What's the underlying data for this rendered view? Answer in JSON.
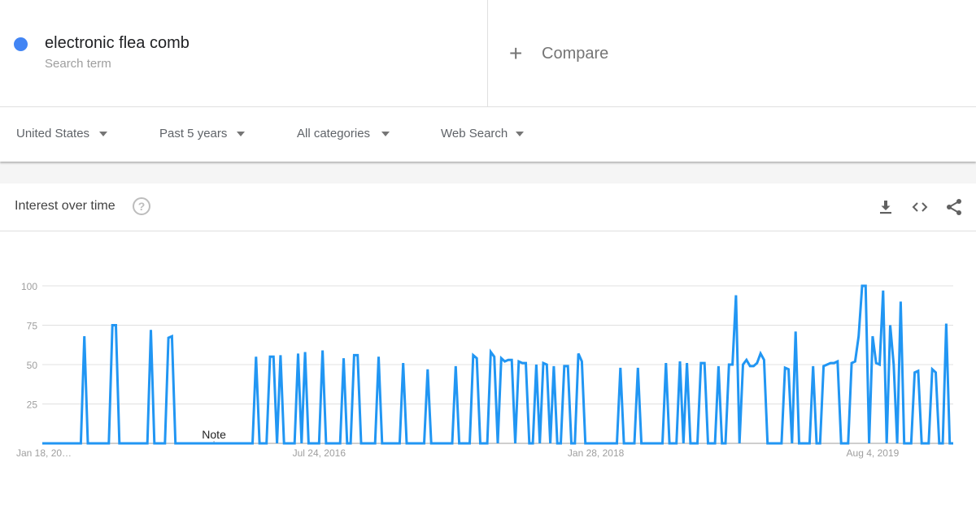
{
  "search_term": {
    "name": "electronic flea comb",
    "type": "Search term",
    "color": "#4285f4"
  },
  "compare": {
    "icon": "plus-icon",
    "label": "Compare"
  },
  "filters": [
    {
      "label": "United States"
    },
    {
      "label": "Past 5 years"
    },
    {
      "label": "All categories"
    },
    {
      "label": "Web Search"
    }
  ],
  "card": {
    "title": "Interest over time",
    "help_icon": "help-icon",
    "actions": [
      "download-icon",
      "embed-icon",
      "share-icon"
    ]
  },
  "chart_data": {
    "type": "line",
    "title": "Interest over time",
    "xlabel": "",
    "ylabel": "",
    "ylim": [
      0,
      100
    ],
    "yticks": [
      25,
      50,
      75,
      100
    ],
    "xtick_labels": [
      {
        "index": 0,
        "label": "Jan 18, 20…"
      },
      {
        "index": 79,
        "label": "Jul 24, 2016"
      },
      {
        "index": 158,
        "label": "Jan 28, 2018"
      },
      {
        "index": 237,
        "label": "Aug 4, 2019"
      }
    ],
    "annotation": {
      "index": 49,
      "label": "Note"
    },
    "grid": true,
    "legend": "none",
    "n_points": 261,
    "frequency": "weekly",
    "series": [
      {
        "name": "electronic flea comb",
        "color": "#2196f3",
        "nonzero_points": [
          [
            12,
            68
          ],
          [
            20,
            75
          ],
          [
            21,
            75
          ],
          [
            31,
            72
          ],
          [
            36,
            67
          ],
          [
            37,
            68
          ],
          [
            61,
            55
          ],
          [
            65,
            55
          ],
          [
            66,
            55
          ],
          [
            68,
            56
          ],
          [
            73,
            57
          ],
          [
            75,
            58
          ],
          [
            80,
            59
          ],
          [
            86,
            54
          ],
          [
            89,
            56
          ],
          [
            90,
            56
          ],
          [
            96,
            55
          ],
          [
            103,
            51
          ],
          [
            110,
            47
          ],
          [
            118,
            49
          ],
          [
            123,
            56
          ],
          [
            124,
            54
          ],
          [
            128,
            58
          ],
          [
            129,
            55
          ],
          [
            131,
            54
          ],
          [
            132,
            52
          ],
          [
            133,
            53
          ],
          [
            134,
            53
          ],
          [
            136,
            52
          ],
          [
            137,
            51
          ],
          [
            138,
            51
          ],
          [
            141,
            50
          ],
          [
            143,
            51
          ],
          [
            144,
            50
          ],
          [
            146,
            49
          ],
          [
            149,
            49
          ],
          [
            150,
            49
          ],
          [
            153,
            57
          ],
          [
            154,
            52
          ],
          [
            165,
            48
          ],
          [
            170,
            48
          ],
          [
            178,
            51
          ],
          [
            182,
            52
          ],
          [
            184,
            51
          ],
          [
            188,
            51
          ],
          [
            189,
            51
          ],
          [
            193,
            49
          ],
          [
            196,
            50
          ],
          [
            197,
            50
          ],
          [
            198,
            94
          ],
          [
            200,
            50
          ],
          [
            201,
            53
          ],
          [
            202,
            49
          ],
          [
            203,
            49
          ],
          [
            204,
            51
          ],
          [
            205,
            57
          ],
          [
            206,
            53
          ],
          [
            212,
            48
          ],
          [
            213,
            47
          ],
          [
            215,
            71
          ],
          [
            220,
            49
          ],
          [
            223,
            49
          ],
          [
            224,
            50
          ],
          [
            225,
            51
          ],
          [
            226,
            51
          ],
          [
            227,
            52
          ],
          [
            231,
            51
          ],
          [
            232,
            52
          ],
          [
            233,
            68
          ],
          [
            234,
            100
          ],
          [
            235,
            100
          ],
          [
            237,
            68
          ],
          [
            238,
            51
          ],
          [
            239,
            50
          ],
          [
            240,
            97
          ],
          [
            242,
            75
          ],
          [
            243,
            50
          ],
          [
            245,
            90
          ],
          [
            249,
            45
          ],
          [
            250,
            46
          ],
          [
            254,
            47
          ],
          [
            255,
            45
          ],
          [
            258,
            76
          ]
        ]
      }
    ]
  }
}
